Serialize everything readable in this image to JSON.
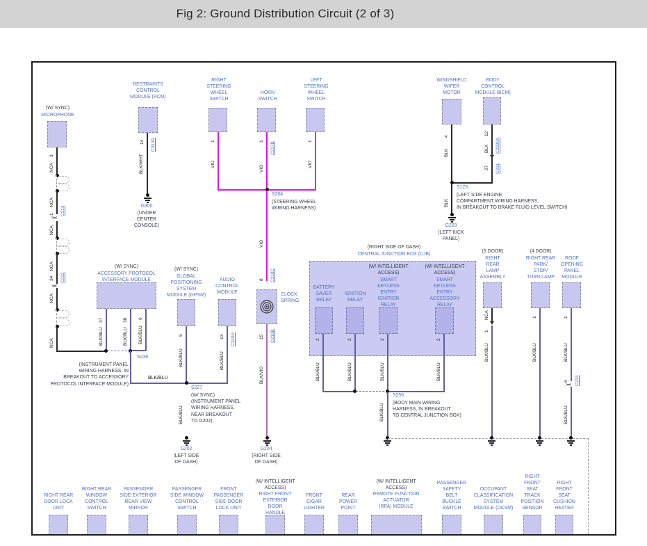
{
  "header": {
    "title": "Fig 2: Ground Distribution Circuit (2 of 3)"
  },
  "w": {
    "nca": "NCA",
    "blk": "BLK",
    "blkblu": "BLK/BLU",
    "blkwht": "BLK/WHT",
    "vio": "VIO",
    "blkvio": "BLK/VIO"
  },
  "p": {
    "1": "1",
    "2": "2",
    "3": "3",
    "4": "4",
    "6": "6",
    "8": "8",
    "12": "12",
    "13": "13",
    "14": "14",
    "15": "15",
    "27": "27",
    "34": "34",
    "37": "37",
    "38": "38"
  },
  "conn": {
    "c211": "C211",
    "c212": "C212",
    "c213": "C213",
    "c217b": "C217B",
    "c218b": "C218B",
    "c218c": "C218C",
    "c2280a": "C2280A",
    "c240a": "C240A",
    "c310a": "C310A"
  },
  "components": {
    "mic": {
      "pfx": "(W/ SYNC)",
      "name": "MICROPHONE"
    },
    "rcm": {
      "name": "RESTRAINTS\nCONTROL\nMODULE (RCM)"
    },
    "rsw": {
      "name": "RIGHT\nSTEERING\nWHEEL\nSWITCH"
    },
    "horn": {
      "name": "HORN\nSWITCH"
    },
    "lsw": {
      "name": "LEFT\nSTEERING\nWHEEL\nSWITCH"
    },
    "cs": {
      "name": "CLOCK\nSPRING"
    },
    "wiper": {
      "name": "WINDSHIELD\nWIPER\nMOTOR"
    },
    "bcm": {
      "name": "BODY\nCONTROL\nMODULE (BCM)"
    },
    "apim": {
      "pfx": "(W/ SYNC)",
      "name": "ACCESSORY PROTOCOL\nINTERFACE MODULE"
    },
    "gpsm": {
      "pfx": "(W/ SYNC)",
      "name": "GLOBAL\nPOSITIONING\nSYSTEM\nMODULE (GPSM)"
    },
    "acm": {
      "name": "AUDIO\nCONTROL\nMODULE"
    },
    "lamp5": {
      "pfx": "(5 DOOR)",
      "name": "RIGHT\nREAR\nLAMP\nASSEMBLY"
    },
    "lamp4": {
      "pfx": "(4 DOOR)",
      "name": "RIGHT REAR\nPARK/\nSTOP/\nTURN LAMP"
    },
    "roof": {
      "name": "ROOF\nOPENING\nPANEL\nMODULE"
    }
  },
  "cjb": {
    "loc": "(RIGHT SIDE OF DASH)",
    "name": "CENTRAL JUNCTION BOX (CJB)",
    "r1": {
      "name": "BATTERY\nSAVER\nRELAY"
    },
    "r2": {
      "name": "IGNITION\nRELAY"
    },
    "r3": {
      "pfx": "(W/ INTELLIGENT\nACCESS)",
      "name": "SMART\nKEYLESS\nENTRY\nIGNITION\nRELAY"
    },
    "r4": {
      "pfx": "(W/ INTELLIGENT\nACCESS)",
      "name": "SMART\nKEYLESS\nENTRY\nACCESSORY\nRELAY"
    }
  },
  "junctions": {
    "s264": {
      "id": "S264",
      "d": "(STEERING WHEEL\nWIRING HARNESS)"
    },
    "s123": {
      "id": "S123",
      "d": "(LEFT SIDE ENGINE\nCOMPARTMENT WIRING HARNESS,\nIN BREAKOUT TO BRAKE FLUID LEVEL SWITCH)"
    },
    "s238": {
      "id": "S238",
      "d": "(INSTRUMENT PANEL\nWIRING HARNESS, IN\nBREAKOUT TO ACCESSORY\nPROTOCOL INTERFACE MODULE)"
    },
    "s227": {
      "id": "S227",
      "d": "(W/ SYNC)\n(INSTRUMENT PANEL\nWIRING HARNESS,\nNEAR BREAKOUT\nTO G202)"
    },
    "s256": {
      "id": "S256",
      "d": "(BODY MAIN WIRING\nHARNESS, IN BREAKOUT\nTO CENTRAL JUNCTION BOX)"
    }
  },
  "grounds": {
    "g300": {
      "id": "G300",
      "d": "(UNDER\nCENTER\nCONSOLE)"
    },
    "g203": {
      "id": "G203",
      "d": "(LEFT KICK\nPANEL)"
    },
    "g202": {
      "id": "G202",
      "d": "(LEFT SIDE\nOF DASH)"
    },
    "g204": {
      "id": "G204",
      "d": "(RIGHT SIDE\nOF DASH)"
    }
  },
  "bm": [
    {
      "name": "RIGHT REAR\nDOOR LOCK\nUNIT"
    },
    {
      "name": "RIGHT REAR\nWINDOW\nCONTROL\nSWITCH"
    },
    {
      "name": "PASSENGER\nSIDE EXTERIOR\nREAR VIEW\nMIRROR"
    },
    {
      "name": "PASSENGER\nSIDE WINDOW\nCONTROL\nSWITCH"
    },
    {
      "name": "FRONT\nPASSENGER\nSIDE DOOR\nLOCK UNIT"
    },
    {
      "pfx": "(W/ INTELLIGENT\nACCESS)",
      "name": "RIGHT FRONT\nEXTERIOR\nDOOR\nHANDLE"
    },
    {
      "name": "FRONT\nCIGAR\nLIGHTER"
    },
    {
      "name": "REAR\nPOWER\nPOINT"
    },
    {
      "pfx": "(W/ INTELLIGENT\nACCESS)",
      "name": "REMOTE FUNCTION\nACTUATOR\n(RFA) MODULE"
    },
    {
      "name": "PASSENGER\nSAFETY\nBELT\nBUCKLE\nSWITCH"
    },
    {
      "name": "OCCUPANT\nCLASSIFICATION\nSYSTEM\nMODULE (OCSM)"
    },
    {
      "name": "RIGHT\nFRONT\nSEAT\nTRACK\nPOSITION\nSENSOR"
    },
    {
      "name": "RIGHT\nFRONT\nSEAT\nCUSHION\nHEATER"
    }
  ],
  "colors": {
    "accent_blue": "#4f6fc8",
    "box_fill": "#c7c7f0",
    "cjb_fill": "#cacaf2",
    "relay_fill": "#b3b3e9",
    "wire_black": "#2b2b2b",
    "wire_blkblu": "#5f5fa8",
    "wire_vio": "#e80ee8",
    "wire_blkvio": "#b06ab0",
    "header_bg": "#d3d3d3"
  }
}
